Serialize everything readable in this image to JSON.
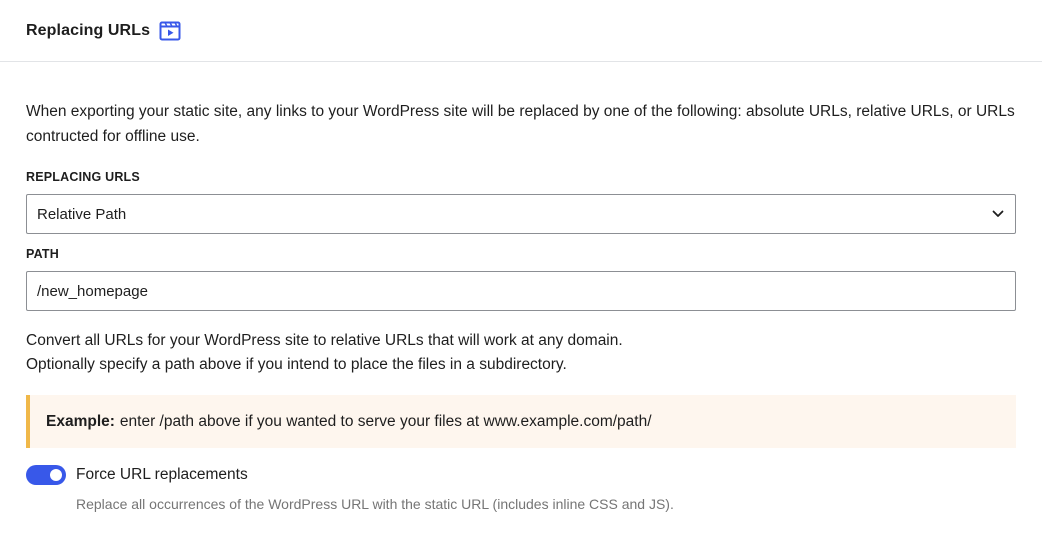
{
  "header": {
    "title": "Replacing URLs",
    "icon": "video-icon",
    "icon_color": "#3858e9"
  },
  "intro": "When exporting your static site, any links to your WordPress site will be replaced by one of the following: absolute URLs, relative URLs, or URLs contructed for offline use.",
  "replacing_urls": {
    "label": "REPLACING URLS",
    "selected": "Relative Path",
    "icon": "chevron-down-icon"
  },
  "path": {
    "label": "PATH",
    "value": "/new_homepage"
  },
  "help": {
    "line1": "Convert all URLs for your WordPress site to relative URLs that will work at any domain.",
    "line2": "Optionally specify a path above if you intend to place the files in a subdirectory."
  },
  "notice": {
    "strong": "Example:",
    "text": "enter /path above if you wanted to serve your files at www.example.com/path/",
    "background": "#fef6ee",
    "border_color": "#f0b849"
  },
  "force_url": {
    "label": "Force URL replacements",
    "enabled": true,
    "help": "Replace all occurrences of the WordPress URL with the static URL (includes inline CSS and JS).",
    "accent": "#3858e9"
  }
}
